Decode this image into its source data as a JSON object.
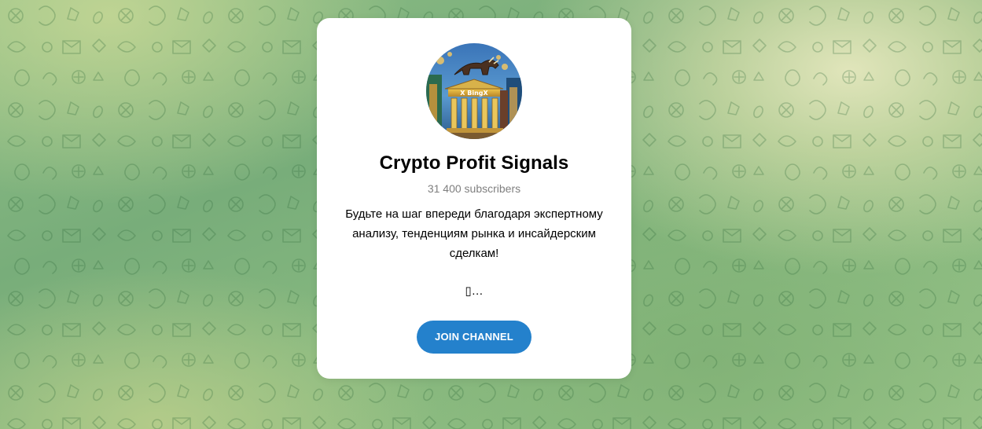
{
  "channel": {
    "title": "Crypto Profit Signals",
    "subscribers": "31 400 subscribers",
    "description": "Будьте на шаг впереди благодаря экспертному анализу, тенденциям рынка и инсайдерским сделкам!",
    "truncated_text": "▯…",
    "avatar_logo_text": "X BingX"
  },
  "actions": {
    "join_label": "JOIN CHANNEL"
  },
  "colors": {
    "accent": "#2481cc",
    "card": "#ffffff",
    "muted": "#7f7f7f"
  },
  "icons": {
    "avatar": "channel-avatar-bull-building"
  }
}
